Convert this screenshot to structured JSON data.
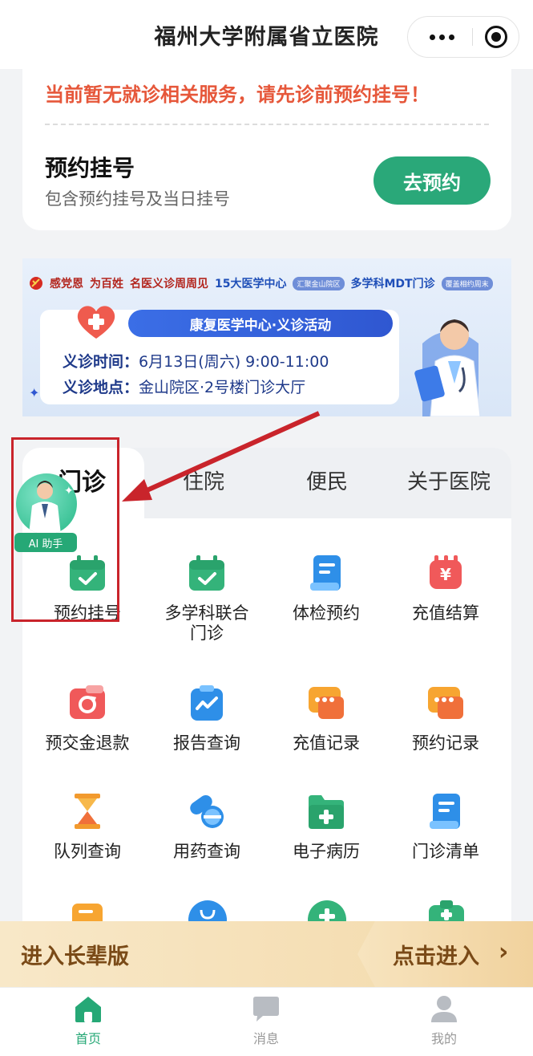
{
  "window": {
    "title": "福州大学附属省立医院"
  },
  "notice": {
    "message": "当前暂无就诊相关服务，请先诊前预约挂号！",
    "registration_title": "预约挂号",
    "registration_subtitle": "包含预约挂号及当日挂号",
    "go_button": "去预约"
  },
  "banner": {
    "strip": [
      "感党恩",
      "为百姓",
      "名医义诊周周见",
      "15大医学中心",
      "汇聚金山院区",
      "多学科MDT门诊",
      "覆盖相约周末"
    ],
    "event_title": "康复医学中心·义诊活动",
    "time_label": "义诊时间：",
    "time_value": "6月13日(周六) 9:00-11:00",
    "place_label": "义诊地点：",
    "place_value": "金山院区·2号楼门诊大厅"
  },
  "tabs": [
    "门诊",
    "住院",
    "便民",
    "关于医院"
  ],
  "ai_helper": {
    "label": "AI 助手"
  },
  "services": [
    {
      "label": "预约挂号",
      "icon": "calendar-check-icon"
    },
    {
      "label": "多学科联合门诊",
      "icon": "calendar-check-icon"
    },
    {
      "label": "体检预约",
      "icon": "document-icon"
    },
    {
      "label": "充值结算",
      "icon": "yuan-payment-icon"
    },
    {
      "label": "预交金退款",
      "icon": "refund-wallet-icon"
    },
    {
      "label": "报告查询",
      "icon": "report-clipboard-icon"
    },
    {
      "label": "充值记录",
      "icon": "chat-bubble-icon"
    },
    {
      "label": "预约记录",
      "icon": "chat-bubble-icon"
    },
    {
      "label": "队列查询",
      "icon": "hourglass-icon"
    },
    {
      "label": "用药查询",
      "icon": "pill-icon"
    },
    {
      "label": "电子病历",
      "icon": "medical-folder-icon"
    },
    {
      "label": "门诊清单",
      "icon": "list-document-icon"
    }
  ],
  "elder_bar": {
    "left_label": "进入长辈版",
    "right_label": "点击进入"
  },
  "bottom_nav": [
    {
      "label": "首页",
      "icon": "home-icon",
      "active": true
    },
    {
      "label": "消息",
      "icon": "message-icon",
      "active": false
    },
    {
      "label": "我的",
      "icon": "user-icon",
      "active": false
    }
  ],
  "colors": {
    "primary_green": "#2aa879",
    "notice_red": "#e6573a",
    "elder_brown": "#7a4a17"
  }
}
